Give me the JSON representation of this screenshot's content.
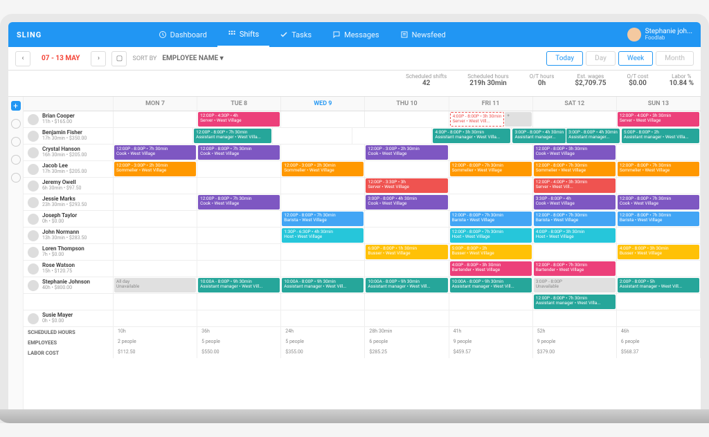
{
  "app": {
    "name": "SLING"
  },
  "nav": {
    "dashboard": "Dashboard",
    "shifts": "Shifts",
    "tasks": "Tasks",
    "messages": "Messages",
    "newsfeed": "Newsfeed"
  },
  "user": {
    "name": "Stephanie joh...",
    "org": "Foodlab"
  },
  "toolbar": {
    "date_range": "07 - 13 MAY",
    "sort_label": "SORT BY",
    "sort_value": "EMPLOYEE NAME",
    "today": "Today",
    "day": "Day",
    "week": "Week",
    "month": "Month"
  },
  "stats": {
    "scheduled_shifts_label": "Scheduled shifts",
    "scheduled_shifts": "42",
    "scheduled_hours_label": "Scheduled hours",
    "scheduled_hours": "219h 30min",
    "ot_hours_label": "O/T hours",
    "ot_hours": "0h",
    "est_wages_label": "Est. wages",
    "est_wages": "$2,709.75",
    "ot_cost_label": "O/T cost",
    "ot_cost": "$0.00",
    "labor_pct_label": "Labor %",
    "labor_pct": "10.84 %"
  },
  "days": [
    "MON 7",
    "TUE 8",
    "WED 9",
    "THU 10",
    "FRI 11",
    "SAT 12",
    "SUN 13"
  ],
  "today_index": 2,
  "employees": [
    {
      "name": "Brian Cooper",
      "sub": "11h • $165.00",
      "shifts": [
        null,
        {
          "c": "c-pink",
          "t": "12:00P - 4:30P • 4h",
          "s": "Server • West Village"
        },
        null,
        null,
        {
          "double": [
            {
              "c": "c-outline",
              "t": "4:00P - 8:00P • 3h 30min",
              "s": "Server • West Vill..."
            },
            {
              "c": "c-gray",
              "t": "+"
            }
          ]
        },
        null,
        {
          "c": "c-pink",
          "t": "12:00P - 4:00P • 3h 30min",
          "s": "Server • West Village"
        }
      ]
    },
    {
      "name": "Benjamin Fisher",
      "sub": "17h 30min • $350.00",
      "shifts": [
        null,
        {
          "c": "c-green",
          "t": "12:00P - 8:00P • 7h 30min",
          "s": "Assistant manager • West Villa..."
        },
        null,
        null,
        {
          "c": "c-green",
          "t": "4:00P - 8:00P • 3h 30min",
          "s": "Assistant manager • West Villa..."
        },
        {
          "double": [
            {
              "c": "c-green",
              "t": "3:00P - 8:00P • 4h 30min",
              "s": "Assistant manager..."
            },
            {
              "c": "c-green",
              "t": "3:00P - 8:00P • 4h 30min",
              "s": "Assistant manager..."
            }
          ]
        },
        {
          "c": "c-green",
          "t": "5:00P - 8:00P • 2h",
          "s": "Assistant manager • West Villa..."
        }
      ]
    },
    {
      "name": "Crystal Hanson",
      "sub": "16h 30min • $205.00",
      "shifts": [
        {
          "c": "c-purple",
          "t": "12:00P - 8:00P • 7h 30min",
          "s": "Cook • West Village"
        },
        {
          "c": "c-purple",
          "t": "12:00P - 8:00P • 7h 30min",
          "s": "Cook • West Village"
        },
        null,
        {
          "c": "c-purple",
          "t": "12:00P - 3:00P • 2h 30min",
          "s": "Cook • West Village"
        },
        null,
        {
          "c": "c-purple",
          "t": "12:00P - 8:00P • 3h 30min",
          "s": "Cook • West Village"
        },
        null
      ]
    },
    {
      "name": "Jacob Lee",
      "sub": "17h 30min • $205.00",
      "shifts": [
        {
          "c": "c-orange",
          "t": "12:00P - 3:00P • 2h 30min",
          "s": "Sommelier • West Village"
        },
        null,
        {
          "c": "c-orange",
          "t": "12:00P - 3:00P • 2h 30min",
          "s": "Sommelier • West Village"
        },
        null,
        {
          "c": "c-orange",
          "t": "12:00P - 8:00P • 7h 30min",
          "s": "Sommelier • West Village"
        },
        {
          "c": "c-orange",
          "t": "12:00P - 8:00P • 7h 30min",
          "s": "Sommelier • West Village"
        },
        {
          "c": "c-orange",
          "t": "12:00P - 8:00P • 7h 30min",
          "s": "Sommelier • West Village"
        }
      ]
    },
    {
      "name": "Jeremy Owell",
      "sub": "6h 30min • $97.50",
      "shifts": [
        null,
        null,
        null,
        {
          "c": "c-red",
          "t": "12:00P - 3:30P • 3h",
          "s": "Server • West Village"
        },
        null,
        {
          "c": "c-red",
          "t": "12:00P - 4:00P • 3h 30min",
          "s": "Server • West Vill..."
        },
        null
      ]
    },
    {
      "name": "Jessie Marks",
      "sub": "23h 30min • $293.50",
      "shifts": [
        null,
        {
          "c": "c-purple",
          "t": "12:00P - 8:00P • 7h 30min",
          "s": "Cook • West Village"
        },
        null,
        {
          "c": "c-purple",
          "t": "3:00P - 8:00P • 4h 30min",
          "s": "Cook • West Village"
        },
        null,
        {
          "c": "c-purple",
          "t": "3:30P - 8:00P • 4h",
          "s": "Cook • West Village"
        },
        {
          "c": "c-purple",
          "t": "12:00P - 8:00P • 7h 30min",
          "s": "Cook • West Village"
        }
      ]
    },
    {
      "name": "Joseph Taylor",
      "sub": "0h • $0.00",
      "shifts": [
        null,
        null,
        {
          "c": "c-blue",
          "t": "12:00P - 8:00P • 7h 30min",
          "s": "Barista • West Village"
        },
        null,
        {
          "c": "c-blue",
          "t": "12:00P - 8:00P • 7h 30min",
          "s": "Barista • West Village"
        },
        {
          "c": "c-blue",
          "t": "12:00P - 8:00P • 7h 30min",
          "s": "Barista • West Village"
        },
        {
          "c": "c-blue",
          "t": "12:00P - 8:00P • 7h 30min",
          "s": "Barista • West Village"
        }
      ]
    },
    {
      "name": "John Normann",
      "sub": "13h 30min • $283.50",
      "shifts": [
        null,
        null,
        {
          "c": "c-teal",
          "t": "1:30P - 6:30P • 4h 30min",
          "s": "Host • West Village"
        },
        null,
        {
          "c": "c-teal",
          "t": "12:00P - 8:00P • 7h 30min",
          "s": "Host • West Village"
        },
        {
          "c": "c-teal",
          "t": "4:00P - 8:00P • 3h 30min",
          "s": "Host • West Village"
        },
        null
      ]
    },
    {
      "name": "Loren Thompson",
      "sub": "7h • $0.00",
      "shifts": [
        null,
        null,
        null,
        {
          "c": "c-yellow",
          "t": "6:00P - 8:00P • 1h 30min",
          "s": "Busser • West Village"
        },
        {
          "c": "c-yellow",
          "t": "5:00P - 8:00P • 2h",
          "s": "Busser • West Village"
        },
        null,
        {
          "c": "c-yellow",
          "t": "4:00P - 8:00P • 3h 30min",
          "s": "Busser • West Village"
        }
      ]
    },
    {
      "name": "Rose Watson",
      "sub": "15h • $120.75",
      "shifts": [
        null,
        null,
        null,
        null,
        {
          "c": "c-pink",
          "t": "4:00P - 8:00P • 3h 30min",
          "s": "Bartender • West Village"
        },
        {
          "c": "c-pink",
          "t": "12:00P - 8:00P • 7h 30min",
          "s": "Bartender • West Village"
        },
        null
      ]
    },
    {
      "name": "Stephanie Johnson",
      "sub": "40h • $800.00",
      "shifts": [
        {
          "c": "c-gray",
          "t": "All day",
          "s": "Unavailable"
        },
        {
          "c": "c-green",
          "t": "10:00A - 8:00P • 9h 30min",
          "s": "Assistant manager • West Vill..."
        },
        {
          "c": "c-green",
          "t": "10:00A - 8:00P • 9h 30min",
          "s": "Assistant manager • West Vill..."
        },
        {
          "c": "c-green",
          "t": "10:00A - 8:00P • 9h 30min",
          "s": "Assistant manager • West Vill..."
        },
        {
          "c": "c-green",
          "t": "10:00A - 8:00P • 9h 30min",
          "s": "Assistant manager • West Vill..."
        },
        {
          "c": "c-gray",
          "t": "3:00P - 8:00P",
          "s": "Unavailable"
        },
        {
          "c": "c-green",
          "t": "2:00P - 8:00P • 5h",
          "s": "Assistant manager • West Vill..."
        }
      ]
    },
    {
      "name": "",
      "sub": "",
      "shifts": [
        null,
        null,
        null,
        null,
        null,
        {
          "c": "c-green",
          "t": "12:00P - 8:00P • 7h 30min",
          "s": "Assistant manager • West Villa..."
        },
        null
      ]
    },
    {
      "name": "Susie Mayer",
      "sub": "0h • $0.00",
      "shifts": [
        null,
        null,
        null,
        null,
        null,
        null,
        null
      ]
    }
  ],
  "footer": {
    "rows": [
      {
        "label": "SCHEDULED HOURS",
        "vals": [
          "10h",
          "36h",
          "24h",
          "28h 30min",
          "41h",
          "52h",
          "46h"
        ]
      },
      {
        "label": "EMPLOYEES",
        "vals": [
          "2 people",
          "5 people",
          "5 people",
          "6 people",
          "9 people",
          "9 people",
          "6 people"
        ]
      },
      {
        "label": "LABOR COST",
        "vals": [
          "$112.50",
          "$550.00",
          "$355.00",
          "$285.25",
          "$459.57",
          "$379.00",
          "$568.37"
        ]
      }
    ]
  }
}
